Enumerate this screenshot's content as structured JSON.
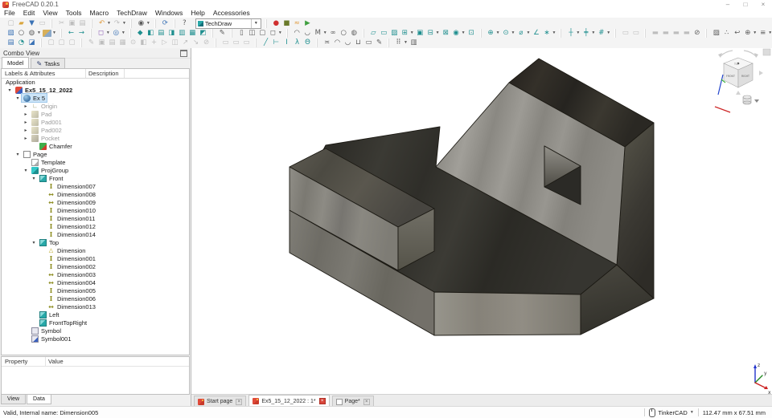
{
  "window": {
    "title": "FreeCAD 0.20.1",
    "controls": [
      "minimize",
      "maximize",
      "close"
    ]
  },
  "menu": [
    "File",
    "Edit",
    "View",
    "Tools",
    "Macro",
    "TechDraw",
    "Windows",
    "Help",
    "Accessories"
  ],
  "toolbar": {
    "workbench_selector": "TechDraw",
    "row1_before": [
      [
        "new-file|▢|dis",
        "open-folder|▰|gold",
        "save-file|▼|blue",
        "print|▭|dis"
      ],
      [
        "cut|✂|dis",
        "copy|▣|dis",
        "paste|▤|dis"
      ],
      [
        "undo|↶|orange|dd",
        "redo|↷|dis|dd"
      ],
      [
        "workbench-tool|◉|gray|dd"
      ],
      [
        "refresh|⟳|blue"
      ],
      [
        "whats-this|?|gray"
      ]
    ],
    "row1_after": [
      [
        "record-macro|●|red",
        "stop-macro|■|olive",
        "edit-macro|≈|orange",
        "play-macro|▶|green"
      ]
    ],
    "row2": [
      [
        "box-selection|▧|blue",
        "zoom-tool|○|gray",
        "scene-inspector|◍|gray|dd",
        "draw-style|◧|multi|dd"
      ],
      [
        "nav-back|←|teal",
        "nav-forward|→|teal"
      ],
      [
        "fit-all|◻|purple|dd",
        "zoom-box|◎|blue|dd"
      ],
      [
        "view-isometric|◆|teal",
        "view-front|◧|teal",
        "view-top|▤|teal",
        "view-right|◨|teal",
        "view-rear|▥|teal",
        "view-bottom|▦|teal",
        "view-left|◩|teal"
      ],
      [
        "measure|✎|gray"
      ],
      [
        "clip-plane|▯|gray",
        "clip-group|◫|gray",
        "persp-view|▢|gray",
        "texture|◻|gray|dd"
      ],
      [
        "arc-up|◠|gray",
        "arc-down|◡|gray",
        "macro-m|M|gray|dd",
        "link-make|∞|gray",
        "link-find|○|gray",
        "appearance|◍|gray"
      ],
      [
        "insert-page|▱|teal",
        "insert-template|▭|teal",
        "redraw-page|▨|teal",
        "projection-group|⊞|teal|dd",
        "insert-view|▣|teal",
        "section-view|⊟|teal|dd",
        "complex-section|⊠|teal",
        "detail-view|◉|teal|dd",
        "clip-view|⊡|teal"
      ],
      [
        "dim-length|⊕|teal|dd",
        "dim-radius|⊙|teal|dd",
        "dim-diameter|⌀|teal|dd",
        "dim-angle|∠|teal",
        "balloon|∗|teal|dd"
      ],
      [
        "ext-centerline|┼|teal|dd",
        "ext-thread|╪|teal|dd",
        "ext-hole|#|teal|dd"
      ],
      [
        "page-prev|▭|dis",
        "page-next|▭|dis"
      ],
      [
        "stack-1|▬|dis",
        "stack-2|▬|dis",
        "stack-3|▬|dis",
        "stack-4|▬|dis",
        "hide-frames|⊘|gray"
      ],
      [
        "image-insert|▨|gray",
        "toggle-nodes|∴|gray",
        "revert|↩|gray",
        "hatch|⊕|gray|dd",
        "stacking|≡|gray|dd",
        "line-tool|╱|teal",
        "move-view|↗|gray",
        "annotate|✎|gray",
        "visible-toggle|◉|gray",
        "frame-box|▫|gray"
      ]
    ],
    "row3": [
      [
        "doc-group|▤|blue",
        "workbench-swoosh|◔|teal",
        "std-cube|◪|blue"
      ],
      [
        "sketch-a|▢|dis",
        "sketch-b|▢|dis",
        "sketch-c|▢|dis"
      ],
      [
        "edit-params|✎|dis",
        "img-a|▣|dis",
        "img-b|▤|dis",
        "grid-view|▦|dis",
        "tag|⊙|dis",
        "camera|◧|dis",
        "add-item|+|dis",
        "play-sim|▷|dis",
        "window-tile|◫|dis",
        "arrow-up|↗|dis",
        "arrow-down|↘|dis",
        "disable|⊘|dis"
      ],
      [
        "doc-a|▭|dis",
        "doc-b|▭|dis",
        "doc-c|▭|dis"
      ],
      [
        "line-stealth|╱|teal",
        "line-h|⊢|teal",
        "line-i|I|teal",
        "line-lambda|λ|teal",
        "line-theta|Θ|teal"
      ],
      [
        "deco-a|≍|gray",
        "deco-b|◠|gray",
        "deco-c|◡|gray",
        "deco-d|⊔|gray",
        "deco-e|▭|gray",
        "deco-f|✎|gray"
      ],
      [
        "grid-dots|⠿|gray|dd",
        "ruler|▥|gray"
      ]
    ]
  },
  "combo_view": {
    "title": "Combo View",
    "tabs": [
      {
        "label": "Model",
        "active": true
      },
      {
        "label": "Tasks",
        "active": false,
        "icon": "pencil"
      }
    ],
    "columns": [
      "Labels & Attributes",
      "Description"
    ],
    "tree": [
      {
        "label": "Application",
        "level": 0
      },
      {
        "label": "Ex5_15_12_2022",
        "level": 1,
        "icon": "doc",
        "arrow": "v",
        "state": "bold"
      },
      {
        "label": "Ex 5",
        "level": 2,
        "icon": "body",
        "arrow": "v",
        "state": "selected"
      },
      {
        "label": "Origin",
        "level": 3,
        "icon": "origin",
        "arrow": ">",
        "state": "disabled"
      },
      {
        "label": "Pad",
        "level": 3,
        "icon": "pad",
        "arrow": ">",
        "state": "disabled"
      },
      {
        "label": "Pad001",
        "level": 3,
        "icon": "pad",
        "arrow": ">",
        "state": "disabled"
      },
      {
        "label": "Pad002",
        "level": 3,
        "icon": "pad",
        "arrow": ">",
        "state": "disabled"
      },
      {
        "label": "Pocket",
        "level": 3,
        "icon": "pocket",
        "arrow": ">",
        "state": "disabled"
      },
      {
        "label": "Chamfer",
        "level": 4,
        "icon": "chamfer"
      },
      {
        "label": "Page",
        "level": 2,
        "icon": "page",
        "arrow": "v"
      },
      {
        "label": "Template",
        "level": 3,
        "icon": "template"
      },
      {
        "label": "ProjGroup",
        "level": 3,
        "icon": "projgroup",
        "arrow": "v"
      },
      {
        "label": "Front",
        "level": 4,
        "icon": "view",
        "arrow": "v"
      },
      {
        "label": "Dimension007",
        "level": 5,
        "icon": "dim-v"
      },
      {
        "label": "Dimension008",
        "level": 5,
        "icon": "dim-h"
      },
      {
        "label": "Dimension009",
        "level": 5,
        "icon": "dim-h"
      },
      {
        "label": "Dimension010",
        "level": 5,
        "icon": "dim-v"
      },
      {
        "label": "Dimension011",
        "level": 5,
        "icon": "dim-v"
      },
      {
        "label": "Dimension012",
        "level": 5,
        "icon": "dim-v"
      },
      {
        "label": "Dimension014",
        "level": 5,
        "icon": "dim-v"
      },
      {
        "label": "Top",
        "level": 4,
        "icon": "view",
        "arrow": "v"
      },
      {
        "label": "Dimension",
        "level": 5,
        "icon": "dim-a"
      },
      {
        "label": "Dimension001",
        "level": 5,
        "icon": "dim-v"
      },
      {
        "label": "Dimension002",
        "level": 5,
        "icon": "dim-v"
      },
      {
        "label": "Dimension003",
        "level": 5,
        "icon": "dim-h"
      },
      {
        "label": "Dimension004",
        "level": 5,
        "icon": "dim-h"
      },
      {
        "label": "Dimension005",
        "level": 5,
        "icon": "dim-v"
      },
      {
        "label": "Dimension006",
        "level": 5,
        "icon": "dim-v"
      },
      {
        "label": "Dimension013",
        "level": 5,
        "icon": "dim-h"
      },
      {
        "label": "Left",
        "level": 4,
        "icon": "view"
      },
      {
        "label": "FrontTopRight",
        "level": 4,
        "icon": "view"
      },
      {
        "label": "Symbol",
        "level": 3,
        "icon": "symbol"
      },
      {
        "label": "Symbol001",
        "level": 3,
        "icon": "symbol2"
      }
    ],
    "property_panel": {
      "columns": [
        "Property",
        "Value"
      ]
    },
    "bottom_tabs": [
      {
        "label": "View",
        "active": false
      },
      {
        "label": "Data",
        "active": true
      }
    ]
  },
  "document_tabs": [
    {
      "label": "Start page",
      "icon": "fc",
      "active": false
    },
    {
      "label": "Ex5_15_12_2022 : 1*",
      "icon": "fc",
      "active": true
    },
    {
      "label": "Page*",
      "icon": "page",
      "active": false
    }
  ],
  "status_bar": {
    "message": "Valid, Internal name: Dimension005",
    "nav_style": "TinkerCAD",
    "dimensions": "112.47 mm x 67.51 mm"
  },
  "viewport": {
    "nav_cube": {
      "faces": [
        "TOP",
        "FRONT",
        "RIGHT"
      ]
    },
    "axis_labels": [
      "z",
      "y",
      "x"
    ]
  }
}
